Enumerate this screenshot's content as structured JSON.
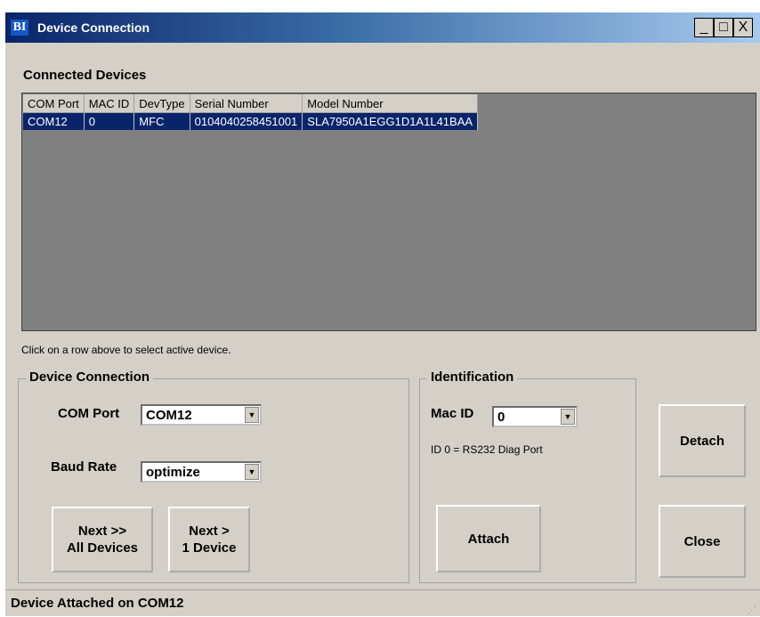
{
  "window": {
    "title": "Device Connection",
    "app_icon_text": "BI",
    "controls": {
      "minimize": "_",
      "maximize": "□",
      "close": "X"
    }
  },
  "connected_devices": {
    "label": "Connected Devices",
    "columns": [
      "COM Port",
      "MAC ID",
      "DevType",
      "Serial Number",
      "Model Number"
    ],
    "rows": [
      [
        "COM12",
        "0",
        "MFC",
        "0104040258451001",
        "SLA7950A1EGG1D1A1L41BAA"
      ]
    ],
    "selected_row": 0,
    "hint": "Click on a row above to select active device."
  },
  "device_connection": {
    "title": "Device Connection",
    "com_port_label": "COM Port",
    "com_port_value": "COM12",
    "baud_rate_label": "Baud Rate",
    "baud_rate_value": "optimize",
    "next_all_label": "Next >>\nAll Devices",
    "next_one_label": "Next >\n1 Device"
  },
  "identification": {
    "title": "Identification",
    "mac_id_label": "Mac ID",
    "mac_id_value": "0",
    "note": "ID 0 = RS232 Diag Port",
    "attach_label": "Attach"
  },
  "actions": {
    "detach_label": "Detach",
    "close_label": "Close"
  },
  "status": {
    "text": "Device Attached on COM12"
  },
  "colors": {
    "title_start": "#0a246a",
    "title_end": "#a6caf0",
    "face": "#d4d0c8",
    "grid_bg": "#808080",
    "selection": "#0a246a"
  },
  "icons": [
    "app-icon",
    "dropdown-arrow-icon",
    "resize-grip-icon"
  ]
}
